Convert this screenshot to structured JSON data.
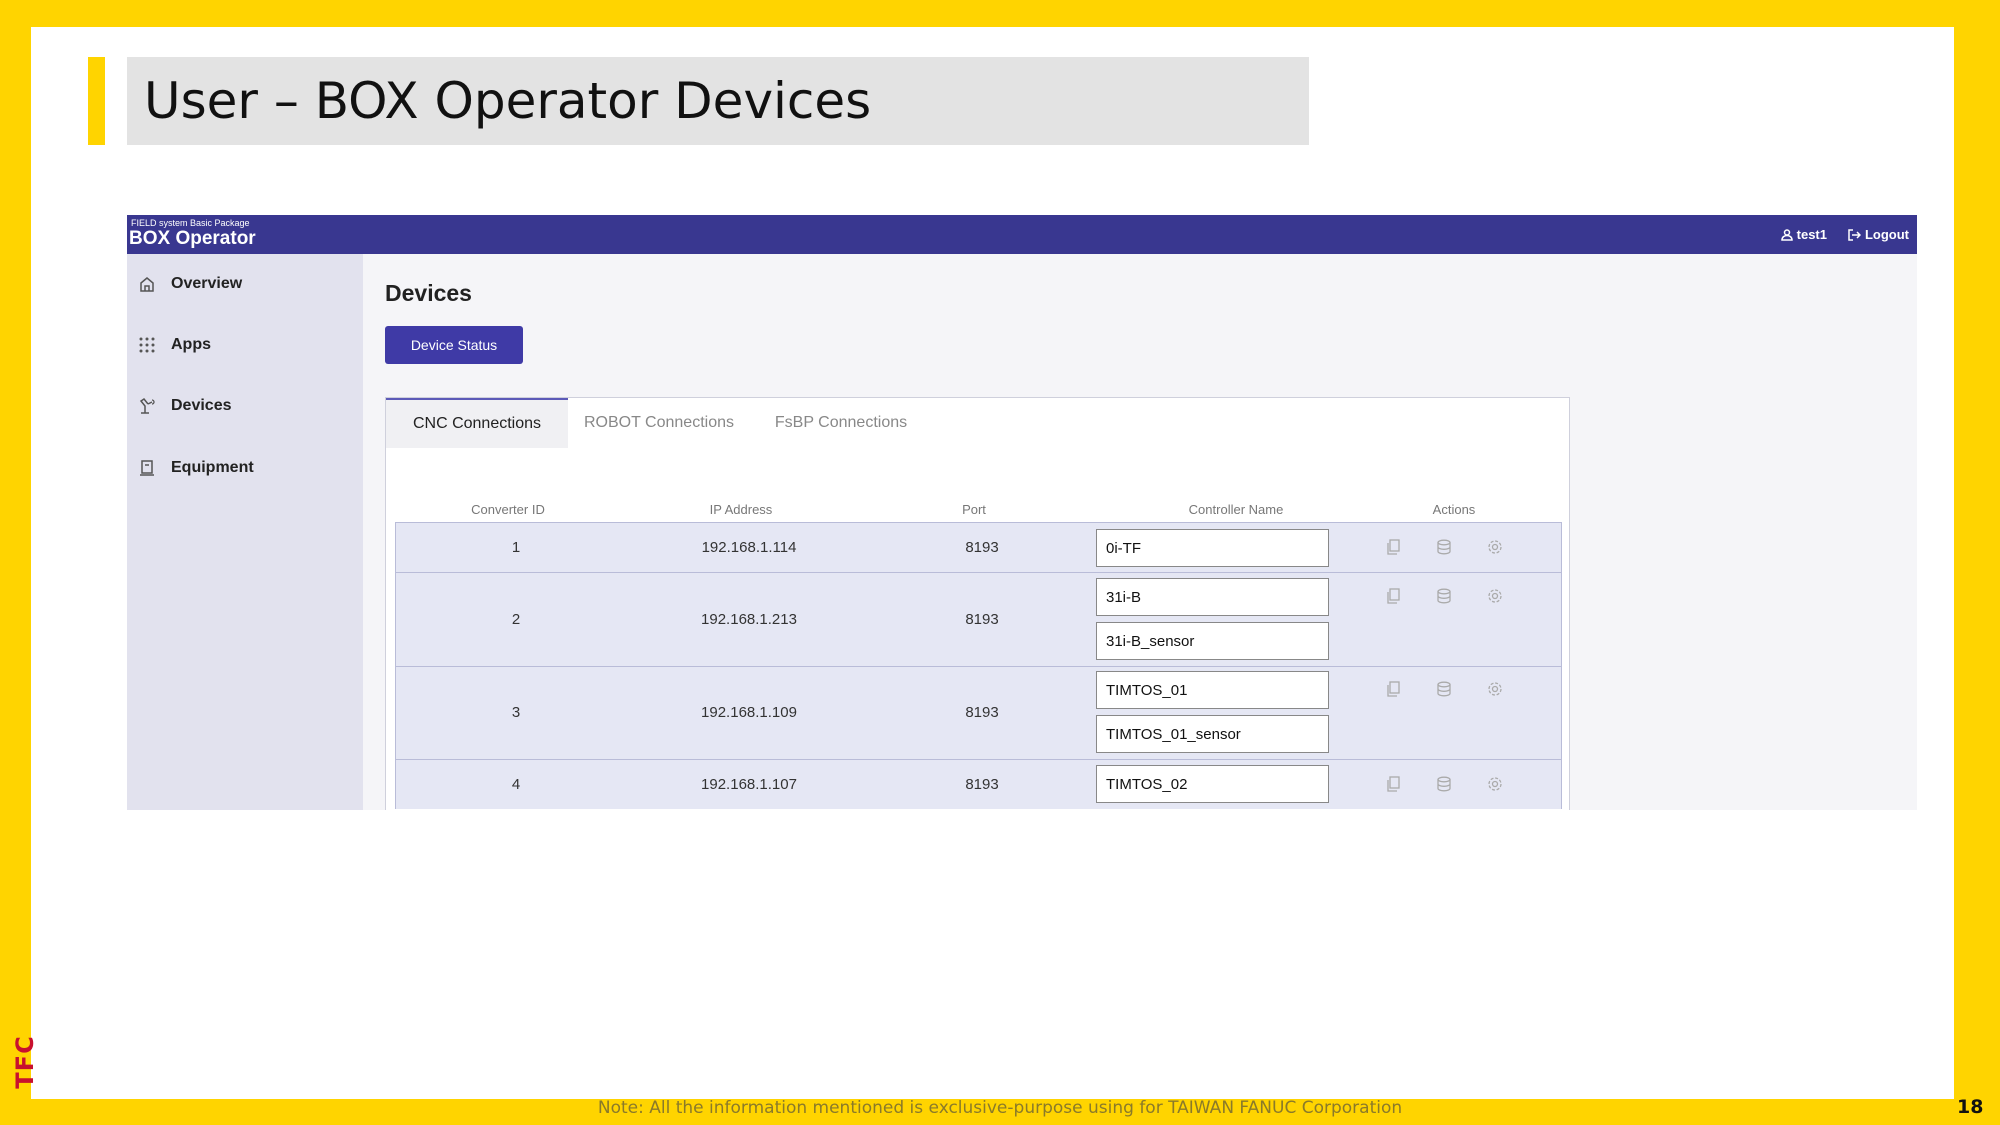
{
  "slide": {
    "title": "User – BOX Operator Devices",
    "note": "Note: All the information mentioned is exclusive-purpose using for TAIWAN FANUC Corporation",
    "page_number": "18",
    "logo_text": "TFC"
  },
  "app": {
    "brand_small": "FIELD system Basic Package",
    "brand": "BOX Operator",
    "user": "test1",
    "logout": "Logout",
    "sidebar": {
      "items": [
        {
          "label": "Overview",
          "icon": "home-icon"
        },
        {
          "label": "Apps",
          "icon": "grid-icon"
        },
        {
          "label": "Devices",
          "icon": "robot-arm-icon"
        },
        {
          "label": "Equipment",
          "icon": "machine-icon"
        }
      ]
    },
    "page_title": "Devices",
    "device_status_button": "Device Status",
    "tabs": [
      {
        "label": "CNC Connections",
        "active": true
      },
      {
        "label": "ROBOT Connections",
        "active": false
      },
      {
        "label": "FsBP Connections",
        "active": false
      }
    ],
    "table": {
      "headers": [
        "Converter ID",
        "IP Address",
        "Port",
        "Controller Name",
        "Actions"
      ],
      "rows": [
        {
          "id": "1",
          "ip": "192.168.1.114",
          "port": "8193",
          "names": [
            "0i-TF"
          ]
        },
        {
          "id": "2",
          "ip": "192.168.1.213",
          "port": "8193",
          "names": [
            "31i-B",
            "31i-B_sensor"
          ]
        },
        {
          "id": "3",
          "ip": "192.168.1.109",
          "port": "8193",
          "names": [
            "TIMTOS_01",
            "TIMTOS_01_sensor"
          ]
        },
        {
          "id": "4",
          "ip": "192.168.1.107",
          "port": "8193",
          "names": [
            "TIMTOS_02"
          ]
        }
      ],
      "action_icons": [
        "copy-icon",
        "database-icon",
        "gear-icon"
      ]
    }
  },
  "colors": {
    "frame": "#ffd400",
    "topbar": "#393790",
    "button": "#3f3aa6",
    "row_bg": "#e5e7f4"
  }
}
